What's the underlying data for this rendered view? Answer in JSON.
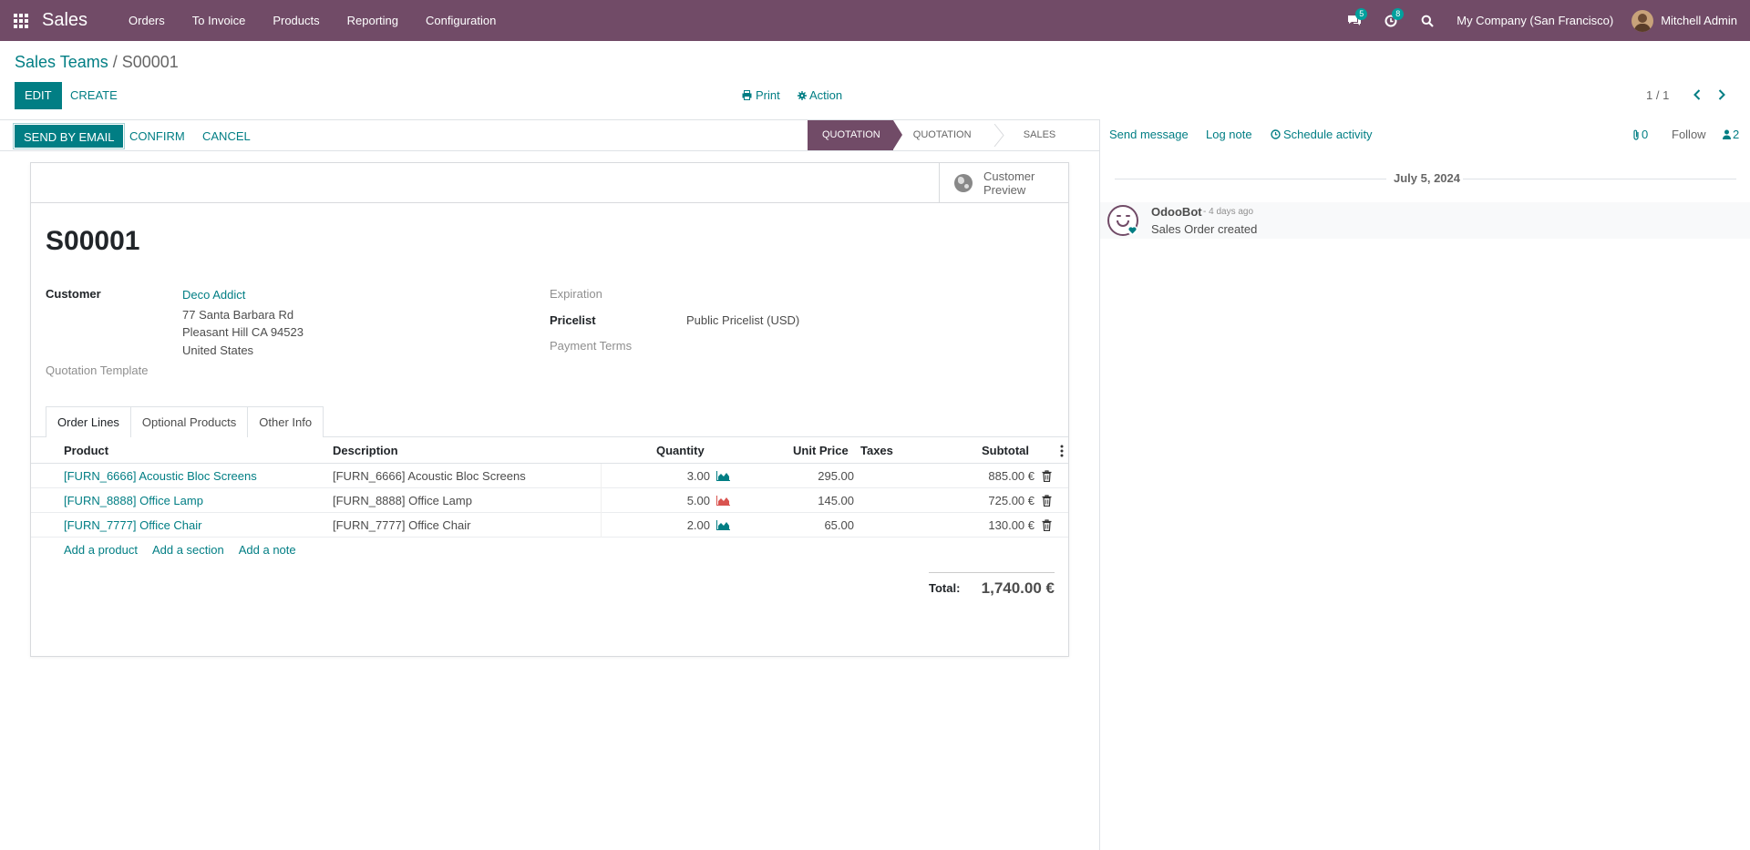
{
  "navbar": {
    "app_name": "Sales",
    "menu": [
      "Orders",
      "To Invoice",
      "Products",
      "Reporting",
      "Configuration"
    ],
    "messages_count": "5",
    "activities_count": "8",
    "company": "My Company (San Francisco)",
    "user": "Mitchell Admin",
    "bg_color": "#714b67"
  },
  "breadcrumb": {
    "parent": "Sales Teams",
    "separator": " / ",
    "current": "S00001"
  },
  "control": {
    "edit": "EDIT",
    "create": "CREATE",
    "print": "Print",
    "action": "Action",
    "pager": "1 / 1"
  },
  "statusbar": {
    "send_by_email": "SEND BY EMAIL",
    "confirm": "CONFIRM",
    "cancel": "CANCEL",
    "stages": [
      "QUOTATION",
      "QUOTATION SENT",
      "SALES ORDER"
    ],
    "current_stage": "QUOTATION"
  },
  "form": {
    "preview_line1": "Customer",
    "preview_line2": "Preview",
    "name": "S00001",
    "customer_label": "Customer",
    "customer_name": "Deco Addict",
    "address_line1": "77 Santa Barbara Rd",
    "address_line2": "Pleasant Hill CA 94523",
    "address_line3": "United States",
    "quotation_template_label": "Quotation Template",
    "expiration_label": "Expiration",
    "pricelist_label": "Pricelist",
    "pricelist_value": "Public Pricelist (USD)",
    "payment_terms_label": "Payment Terms"
  },
  "tabs": [
    "Order Lines",
    "Optional Products",
    "Other Info"
  ],
  "table": {
    "headers": {
      "product": "Product",
      "description": "Description",
      "quantity": "Quantity",
      "unit_price": "Unit Price",
      "taxes": "Taxes",
      "subtotal": "Subtotal"
    },
    "rows": [
      {
        "product": "[FURN_6666] Acoustic Bloc Screens",
        "description": "[FURN_6666] Acoustic Bloc Screens",
        "quantity": "3.00",
        "unit_price": "295.00",
        "taxes": "",
        "subtotal": "885.00 €",
        "forecast_color": "#017e84"
      },
      {
        "product": "[FURN_8888] Office Lamp",
        "description": "[FURN_8888] Office Lamp",
        "quantity": "5.00",
        "unit_price": "145.00",
        "taxes": "",
        "subtotal": "725.00 €",
        "forecast_color": "#d9534f"
      },
      {
        "product": "[FURN_7777] Office Chair",
        "description": "[FURN_7777] Office Chair",
        "quantity": "2.00",
        "unit_price": "65.00",
        "taxes": "",
        "subtotal": "130.00 €",
        "forecast_color": "#017e84"
      }
    ],
    "add_product": "Add a product",
    "add_section": "Add a section",
    "add_note": "Add a note"
  },
  "totals": {
    "label": "Total:",
    "value": "1,740.00 €"
  },
  "chatter": {
    "send_message": "Send message",
    "log_note": "Log note",
    "schedule_activity": "Schedule activity",
    "attachments_count": "0",
    "follow": "Follow",
    "followers_count": "2",
    "date": "July 5, 2024",
    "message": {
      "author": "OdooBot",
      "time": "- 4 days ago",
      "body": "Sales Order created"
    }
  },
  "colors": {
    "primary": "#017e84",
    "brand": "#714b67"
  }
}
